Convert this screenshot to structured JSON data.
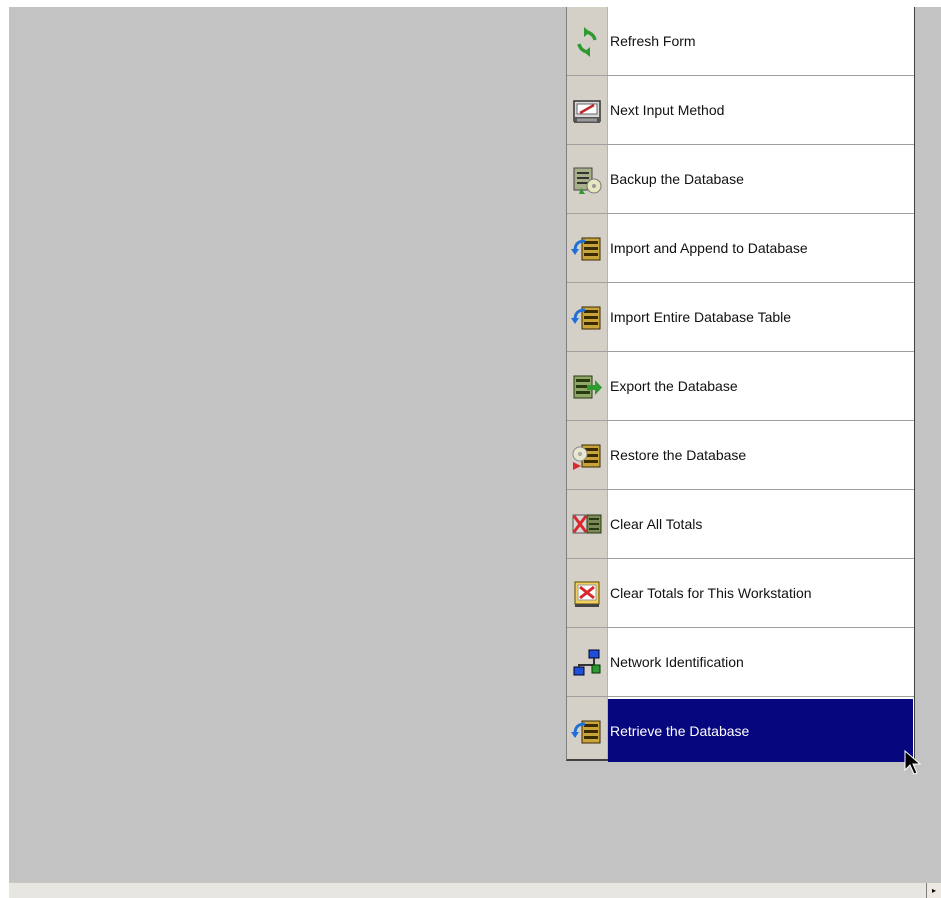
{
  "menu": {
    "items": [
      {
        "label": "Refresh Form",
        "icon": "refresh-icon",
        "selected": false
      },
      {
        "label": "Next Input Method",
        "icon": "input-method-icon",
        "selected": false
      },
      {
        "label": "Backup the Database",
        "icon": "backup-icon",
        "selected": false
      },
      {
        "label": "Import and Append to Database",
        "icon": "import-icon",
        "selected": false
      },
      {
        "label": "Import Entire Database Table",
        "icon": "import-icon",
        "selected": false
      },
      {
        "label": "Export the Database",
        "icon": "export-icon",
        "selected": false
      },
      {
        "label": "Restore the Database",
        "icon": "restore-icon",
        "selected": false
      },
      {
        "label": "Clear All Totals",
        "icon": "clear-all-icon",
        "selected": false
      },
      {
        "label": "Clear Totals for This Workstation",
        "icon": "clear-workstation-icon",
        "selected": false
      },
      {
        "label": "Network Identification",
        "icon": "network-icon",
        "selected": false
      },
      {
        "label": "Retrieve the Database",
        "icon": "retrieve-icon",
        "selected": true
      }
    ]
  },
  "scrollbar": {
    "right_arrow": "▸"
  },
  "colors": {
    "selection": "#06067e",
    "background": "#c3c3c3",
    "menu_bg": "#ffffff"
  }
}
